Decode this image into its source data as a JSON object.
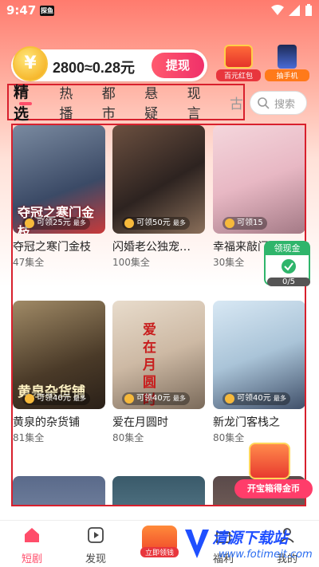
{
  "status": {
    "time": "9:47",
    "badge": "探鱼"
  },
  "coins": {
    "symbol": "¥",
    "text": "2800≈0.28元",
    "withdraw": "提现"
  },
  "rewards": [
    {
      "label": "百元红包"
    },
    {
      "label": "抽手机"
    }
  ],
  "tabs": [
    "精选",
    "热播",
    "都市",
    "悬疑",
    "现言",
    "古"
  ],
  "search": {
    "placeholder": "搜索"
  },
  "cards": [
    {
      "title": "夺冠之寒门金枝",
      "eps": "47集全",
      "reward": "可领25元",
      "extra": "最多",
      "overlay": "夺冠之寒门金枝"
    },
    {
      "title": "闪婚老公独宠…",
      "eps": "100集全",
      "reward": "可领50元",
      "extra": "最多",
      "overlay": ""
    },
    {
      "title": "幸福来敲门",
      "eps": "30集全",
      "reward": "可领15",
      "extra": "",
      "overlay": ""
    },
    {
      "title": "黄泉的杂货铺",
      "eps": "81集全",
      "reward": "可领40元",
      "extra": "最多",
      "overlay": "黄泉杂货铺"
    },
    {
      "title": "爱在月圆时",
      "eps": "80集全",
      "reward": "可领40元",
      "extra": "最多",
      "overlay": "爱在月圆时"
    },
    {
      "title": "新龙门客栈之",
      "eps": "80集全",
      "reward": "可领40元",
      "extra": "最多",
      "overlay": ""
    }
  ],
  "float": {
    "label": "领现金",
    "count": "0/5"
  },
  "chest": {
    "cta": "开宝箱得金币"
  },
  "nav": [
    {
      "label": "短剧"
    },
    {
      "label": "发现"
    },
    {
      "label": "立即领钱"
    },
    {
      "label": "福利"
    },
    {
      "label": "我的"
    }
  ],
  "watermark": {
    "name": "清源下载站",
    "url": "www.fotimeit.com"
  },
  "colors": {
    "accent": "#ff4d6a",
    "highlight_border": "#d8202d"
  }
}
